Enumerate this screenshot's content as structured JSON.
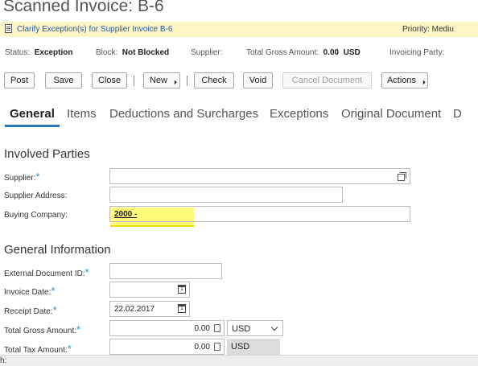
{
  "page": {
    "title": "Scanned Invoice: B-6"
  },
  "task": {
    "text": "Clarify Exception(s) for Supplier Invoice B-6",
    "priority": "Priority: Mediu"
  },
  "status": {
    "status_label": "Status:",
    "status_value": "Exception",
    "block_label": "Block:",
    "block_value": "Not Blocked",
    "supplier_label": "Supplier:",
    "gross_label": "Total Gross Amount:",
    "gross_value": "0.00",
    "gross_currency": "USD",
    "invoicing_label": "Invoicing Party:"
  },
  "toolbar": {
    "post": "Post",
    "save": "Save",
    "close": "Close",
    "new": "New",
    "check": "Check",
    "void": "Void",
    "cancel_document": "Cancel Document",
    "actions": "Actions"
  },
  "tabs": [
    "General",
    "Items",
    "Deductions and Surcharges",
    "Exceptions",
    "Original Document",
    "D"
  ],
  "involved_parties": {
    "title": "Involved Parties",
    "supplier_label": "Supplier:",
    "supplier_address_label": "Supplier Address:",
    "buying_company_label": "Buying Company:",
    "buying_company_value": "2000 -"
  },
  "general_info": {
    "title": "General Information",
    "external_doc_label": "External Document ID:",
    "invoice_date_label": "Invoice Date:",
    "receipt_date_label": "Receipt Date:",
    "receipt_date_value": "22.02.2017",
    "total_gross_label": "Total Gross Amount:",
    "total_gross_value": "0.00",
    "total_gross_currency": "USD",
    "total_tax_label": "Total Tax Amount:",
    "total_tax_value": "0.00",
    "total_tax_currency": "USD"
  },
  "footer": {
    "text": "h:"
  },
  "colors": {
    "accent": "#2b78c2",
    "task_bar": "#fff6c8",
    "highlight": "#fffb7a",
    "required": "#2f8fd8"
  }
}
